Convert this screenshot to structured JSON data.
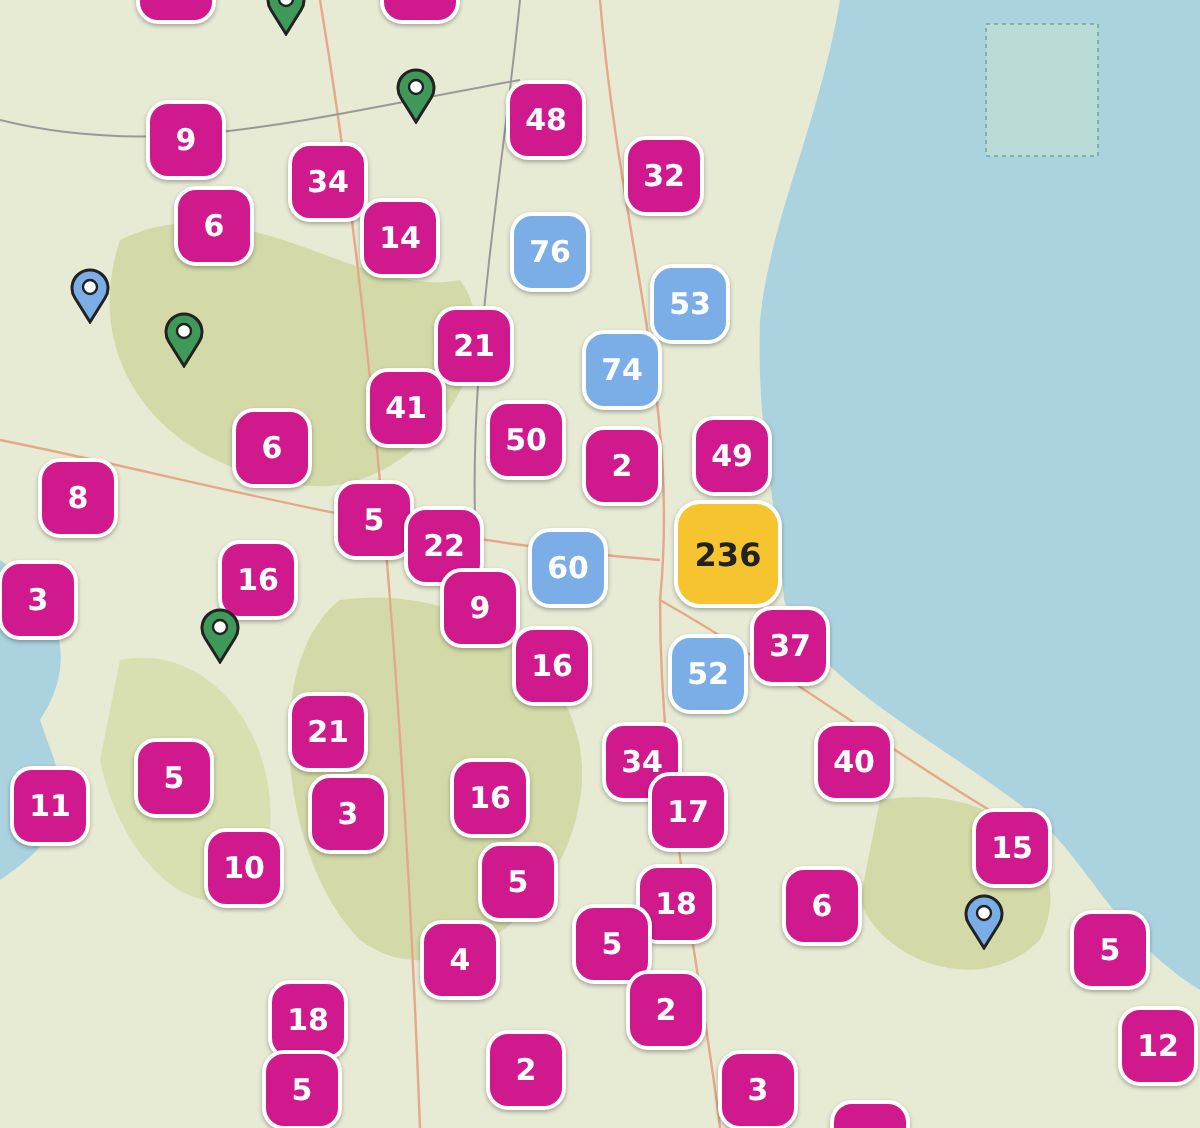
{
  "map": {
    "clusters": [
      {
        "kind": "clipped",
        "color": "#d0198c"
      },
      {
        "kind": "clipped",
        "color": "#d0198c"
      },
      {
        "kind": "cluster",
        "count": "9",
        "color": "#d0198c"
      },
      {
        "kind": "cluster",
        "count": "48",
        "color": "#d0198c"
      },
      {
        "kind": "cluster",
        "count": "34",
        "color": "#d0198c"
      },
      {
        "kind": "cluster",
        "count": "32",
        "color": "#d0198c"
      },
      {
        "kind": "cluster",
        "count": "6",
        "color": "#d0198c"
      },
      {
        "kind": "cluster",
        "count": "14",
        "color": "#d0198c"
      },
      {
        "kind": "cluster",
        "count": "76",
        "color": "#7baee6"
      },
      {
        "kind": "cluster",
        "count": "53",
        "color": "#7baee6"
      },
      {
        "kind": "cluster",
        "count": "21",
        "color": "#d0198c"
      },
      {
        "kind": "cluster",
        "count": "74",
        "color": "#7baee6"
      },
      {
        "kind": "cluster",
        "count": "41",
        "color": "#d0198c"
      },
      {
        "kind": "cluster",
        "count": "6",
        "color": "#d0198c"
      },
      {
        "kind": "cluster",
        "count": "50",
        "color": "#d0198c"
      },
      {
        "kind": "cluster",
        "count": "2",
        "color": "#d0198c"
      },
      {
        "kind": "cluster",
        "count": "49",
        "color": "#d0198c"
      },
      {
        "kind": "cluster",
        "count": "8",
        "color": "#d0198c"
      },
      {
        "kind": "cluster",
        "count": "5",
        "color": "#d0198c"
      },
      {
        "kind": "cluster",
        "count": "22",
        "color": "#d0198c"
      },
      {
        "kind": "cluster",
        "count": "236",
        "color": "#f6c42f"
      },
      {
        "kind": "cluster",
        "count": "60",
        "color": "#7baee6"
      },
      {
        "kind": "cluster",
        "count": "3",
        "color": "#d0198c"
      },
      {
        "kind": "cluster",
        "count": "16",
        "color": "#d0198c"
      },
      {
        "kind": "cluster",
        "count": "9",
        "color": "#d0198c"
      },
      {
        "kind": "cluster",
        "count": "16",
        "color": "#d0198c"
      },
      {
        "kind": "cluster",
        "count": "37",
        "color": "#d0198c"
      },
      {
        "kind": "cluster",
        "count": "52",
        "color": "#7baee6"
      },
      {
        "kind": "cluster",
        "count": "21",
        "color": "#d0198c"
      },
      {
        "kind": "cluster",
        "count": "5",
        "color": "#d0198c"
      },
      {
        "kind": "cluster",
        "count": "34",
        "color": "#d0198c"
      },
      {
        "kind": "cluster",
        "count": "40",
        "color": "#d0198c"
      },
      {
        "kind": "cluster",
        "count": "11",
        "color": "#d0198c"
      },
      {
        "kind": "cluster",
        "count": "3",
        "color": "#d0198c"
      },
      {
        "kind": "cluster",
        "count": "16",
        "color": "#d0198c"
      },
      {
        "kind": "cluster",
        "count": "17",
        "color": "#d0198c"
      },
      {
        "kind": "cluster",
        "count": "10",
        "color": "#d0198c"
      },
      {
        "kind": "cluster",
        "count": "15",
        "color": "#d0198c"
      },
      {
        "kind": "cluster",
        "count": "5",
        "color": "#d0198c"
      },
      {
        "kind": "cluster",
        "count": "18",
        "color": "#d0198c"
      },
      {
        "kind": "cluster",
        "count": "6",
        "color": "#d0198c"
      },
      {
        "kind": "cluster",
        "count": "5",
        "color": "#d0198c"
      },
      {
        "kind": "cluster",
        "count": "4",
        "color": "#d0198c"
      },
      {
        "kind": "cluster",
        "count": "5",
        "color": "#d0198c"
      },
      {
        "kind": "cluster",
        "count": "2",
        "color": "#d0198c"
      },
      {
        "kind": "cluster",
        "count": "18",
        "color": "#d0198c"
      },
      {
        "kind": "cluster",
        "count": "12",
        "color": "#d0198c"
      },
      {
        "kind": "cluster",
        "count": "2",
        "color": "#d0198c"
      },
      {
        "kind": "cluster",
        "count": "5",
        "color": "#d0198c"
      },
      {
        "kind": "cluster",
        "count": "3",
        "color": "#d0198c"
      },
      {
        "kind": "clipped",
        "color": "#d0198c"
      }
    ],
    "pins": [
      {
        "color": "#3f9a5a"
      },
      {
        "color": "#3f9a5a"
      },
      {
        "color": "#7baee6"
      },
      {
        "color": "#3f9a5a"
      },
      {
        "color": "#3f9a5a"
      },
      {
        "color": "#7baee6"
      }
    ]
  }
}
